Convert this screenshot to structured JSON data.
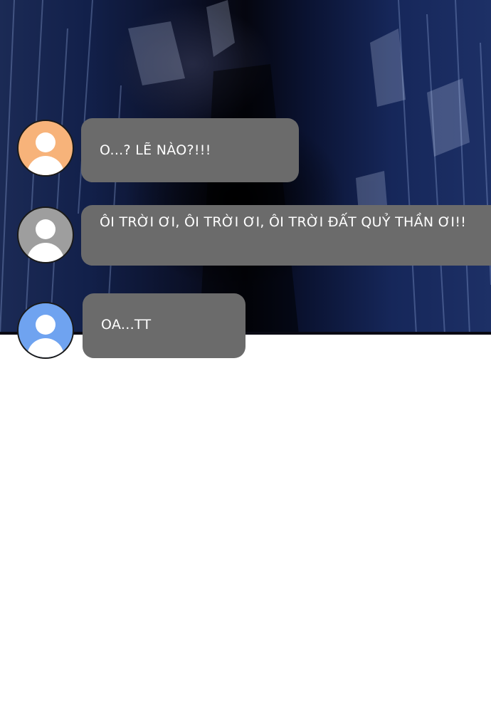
{
  "chat": {
    "messages": [
      {
        "text": "O...? LẼ NÀO?!!!",
        "avatar_icon": "user-avatar-icon",
        "avatar_color": "#f7b37a"
      },
      {
        "text": "ÔI TRỜI ƠI, ÔI TRỜI ƠI, ÔI TRỜI ĐẤT QUỶ THẦN ƠI!!",
        "avatar_icon": "user-avatar-icon",
        "avatar_color": "#9e9e9e"
      },
      {
        "text": "OA...TT",
        "avatar_icon": "user-avatar-icon",
        "avatar_color": "#6fa3f0"
      }
    ],
    "bubble_color": "#6b6b6b"
  }
}
